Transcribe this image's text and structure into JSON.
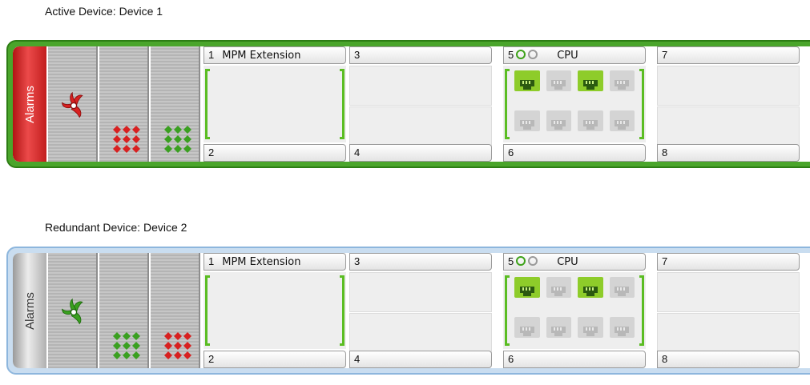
{
  "devices": [
    {
      "title": "Active Device: Device 1",
      "alarms_label": "Alarms",
      "alarm_state": "active",
      "psu_dots": [
        "red",
        "green"
      ],
      "slots": {
        "s1": "1",
        "s1_name": "MPM Extension",
        "s2": "2",
        "s3": "3",
        "s4": "4",
        "s5": "5",
        "s5_name": "CPU",
        "s6": "6",
        "s7": "7",
        "s8": "8"
      },
      "cpu_ports_top": [
        "on",
        "off",
        "on",
        "off"
      ],
      "cpu_ports_bottom": [
        "off",
        "off",
        "off",
        "off"
      ],
      "cpu_leds": [
        "green",
        "grey"
      ]
    },
    {
      "title": "Redundant Device: Device 2",
      "alarms_label": "Alarms",
      "alarm_state": "ok",
      "psu_dots": [
        "green",
        "red"
      ],
      "slots": {
        "s1": "1",
        "s1_name": "MPM Extension",
        "s2": "2",
        "s3": "3",
        "s4": "4",
        "s5": "5",
        "s5_name": "CPU",
        "s6": "6",
        "s7": "7",
        "s8": "8"
      },
      "cpu_ports_top": [
        "on",
        "off",
        "on",
        "off"
      ],
      "cpu_ports_bottom": [
        "off",
        "off",
        "off",
        "off"
      ],
      "cpu_leds": [
        "green",
        "grey"
      ]
    }
  ],
  "colors": {
    "active_frame": "#4aa52b",
    "redundant_frame": "#c9ddf0",
    "alarm_red": "#e03030",
    "port_on": "#8ecc2a",
    "port_off": "#d4d4d4",
    "dot_red": "#d82020",
    "dot_green": "#3aa020"
  }
}
